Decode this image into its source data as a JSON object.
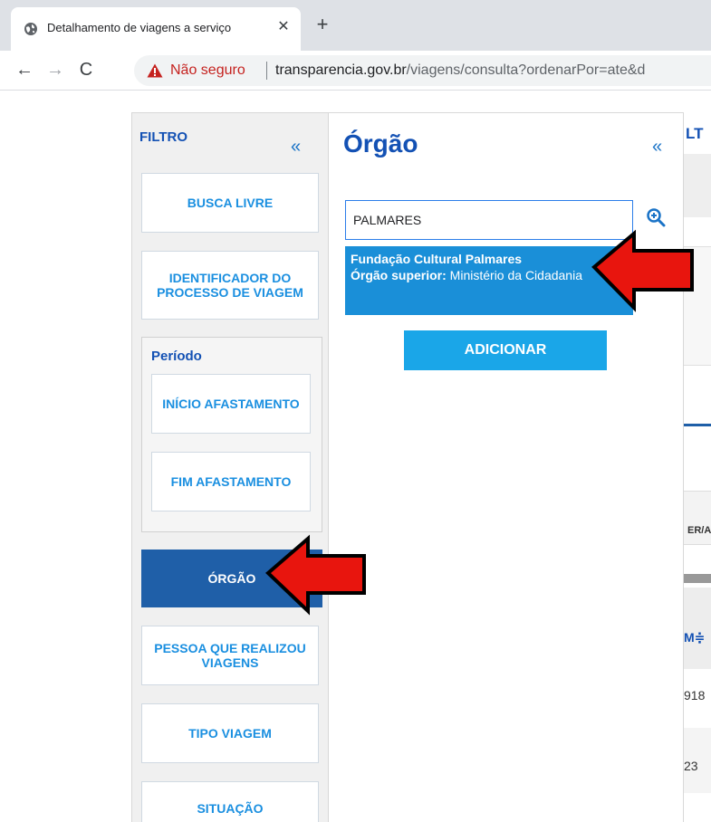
{
  "browser": {
    "tab_title": "Detalhamento de viagens a serviço",
    "tab_close": "✕",
    "new_tab": "+",
    "nav": {
      "back": "←",
      "forward": "→",
      "reload": "C"
    },
    "security_label": "Não seguro",
    "url_domain": "transparencia.gov.br",
    "url_path": "/viagens/consulta?ordenarPor=ate&d"
  },
  "sidebar": {
    "title": "FILTRO",
    "collapse": "«",
    "buttons": {
      "busca_livre": "BUSCA LIVRE",
      "identificador": "IDENTIFICADOR DO PROCESSO DE VIAGEM",
      "orgao": "ÓRGÃO",
      "pessoa": "PESSOA QUE REALIZOU VIAGENS",
      "tipo": "TIPO VIAGEM",
      "situacao": "SITUAÇÃO"
    },
    "periodo": {
      "label": "Período",
      "inicio": "INÍCIO AFASTAMENTO",
      "fim": "FIM AFASTAMENTO"
    }
  },
  "panel": {
    "title": "Órgão",
    "collapse": "«",
    "search_value": "PALMARES",
    "suggestion": {
      "name": "Fundação Cultural Palmares",
      "superior_label": "Órgão superior:",
      "superior_value": " Ministério da Cidadania"
    },
    "add_button": "ADICIONAR"
  },
  "background": {
    "ult_fragment": "LT",
    "header_fragment": "ER/A",
    "col_fragment": "M≑",
    "value_1": "918",
    "value_2": "23"
  },
  "colors": {
    "primary": "#1351b4",
    "active_button": "#1f5fa8",
    "add_button": "#1aa6e8",
    "suggestion": "#1a8fd8",
    "annotation_arrow": "#e8150e",
    "warning": "#c5221f"
  }
}
